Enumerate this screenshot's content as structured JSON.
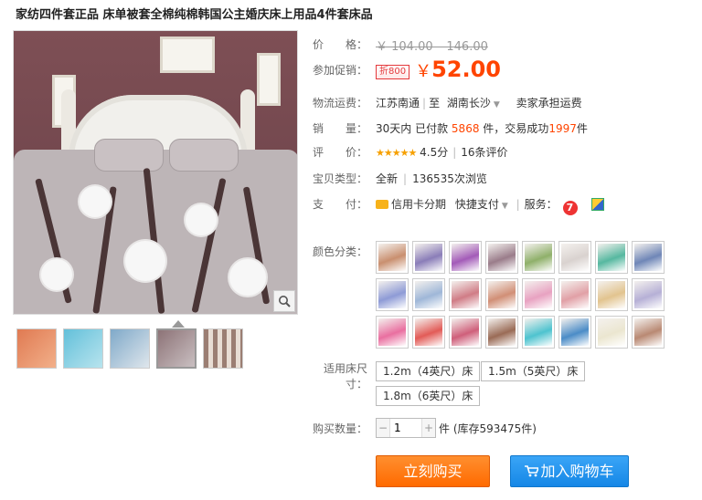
{
  "title": "家纺四件套正品 床单被套全棉纯棉韩国公主婚庆床上用品4件套床品",
  "price": {
    "label": "价　　格：",
    "original": "￥ 104.00 – 146.00"
  },
  "promo": {
    "label": "参加促销：",
    "badge": "折800",
    "currency": "￥",
    "value": "52.00"
  },
  "shipping": {
    "label": "物流运费：",
    "from": "江苏南通",
    "to_prefix": "至",
    "to": "湖南长沙",
    "fee": "卖家承担运费"
  },
  "sales": {
    "label": "销　　量：",
    "prefix": "30天内 已付款",
    "paid": "5868",
    "mid": "件，交易成功",
    "success": "1997",
    "suffix": "件"
  },
  "rating": {
    "label": "评　　价：",
    "stars": "★★★★★",
    "score": "4.5分",
    "reviews": "16条评价"
  },
  "item_type": {
    "label": "宝贝类型：",
    "condition": "全新",
    "views": "136535次浏览"
  },
  "payment": {
    "label": "支　　付：",
    "installment": "信用卡分期",
    "quick": "快捷支付",
    "service_label": "服务："
  },
  "color": {
    "label": "颜色分类："
  },
  "size": {
    "label": "适用床尺寸：",
    "options": [
      "1.2m（4英尺）床",
      "1.5m（5英尺）床",
      "1.8m（6英尺）床"
    ]
  },
  "quantity": {
    "label": "购买数量：",
    "value": "1",
    "stock": "件 (库存593475件)"
  },
  "buttons": {
    "buy": "立刻购买",
    "cart": "加入购物车"
  },
  "colors": {
    "accent": "#ff4400",
    "buy": "#ff6a00",
    "cart": "#1587e6",
    "swatches": [
      "#c98f6f",
      "#8a7db8",
      "#a35bb8",
      "#9a7c8a",
      "#8fb06a",
      "#d9d2cf",
      "#56b8a0",
      "#6f86b7",
      "#8e9bd6",
      "#9fb7d8",
      "#d07c86",
      "#d18f76",
      "#e8a2c1",
      "#e1a0a6",
      "#e2c48f",
      "#b6b0d6",
      "#e96fa0",
      "#e25b57",
      "#cf5f7a",
      "#9a6b56",
      "#4ec3cf",
      "#4b8cc7",
      "#ebe6d0",
      "#b98973"
    ],
    "thumbs": [
      "#e07a52",
      "#63c0da",
      "#7fa9c9",
      "#8d7377",
      "#9b7e73"
    ]
  },
  "icons": {
    "zoom": "magnifier-icon",
    "cart": "cart-icon",
    "service_7": "seven-day-return-icon",
    "service_2": "guarantee-icon"
  }
}
